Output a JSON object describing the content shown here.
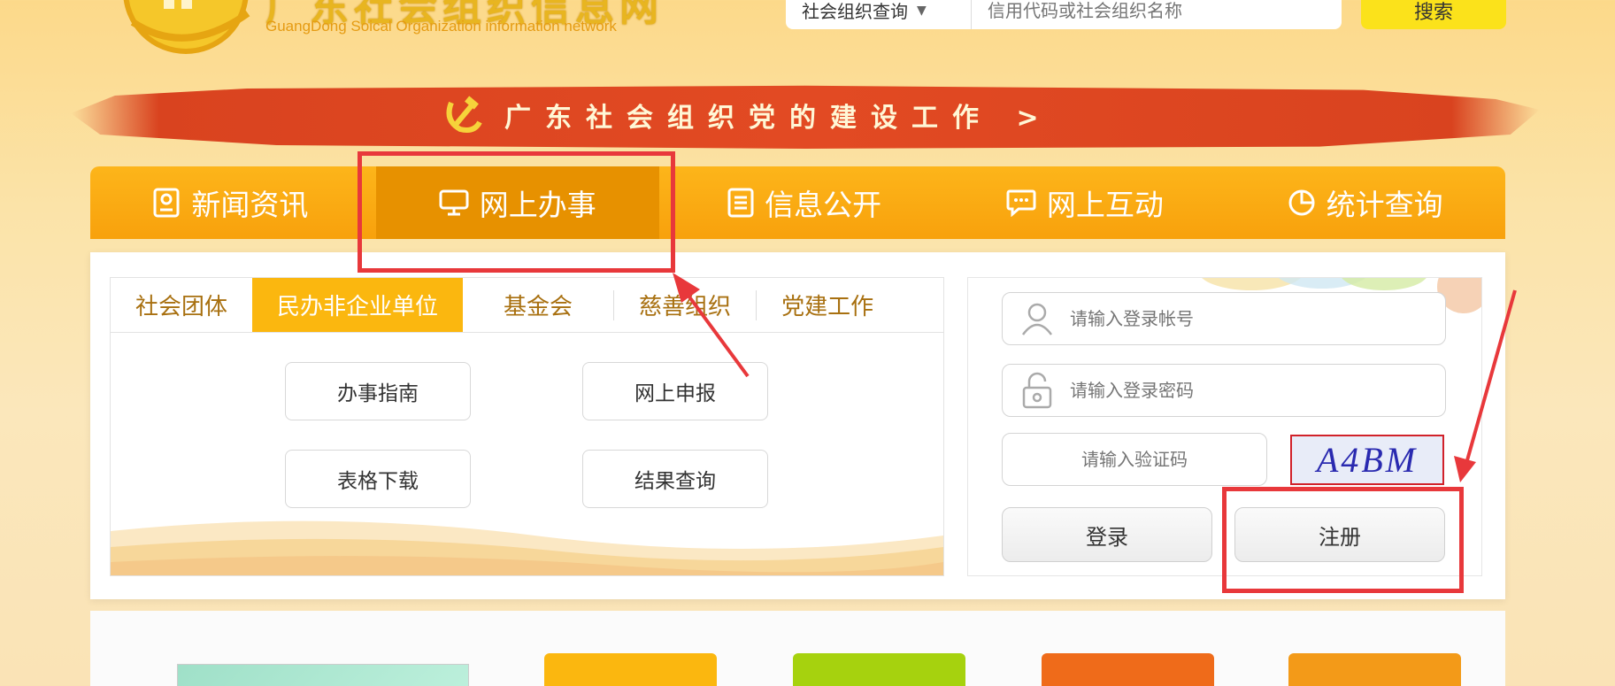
{
  "header": {
    "logo_cn": "广东社会组织信息网",
    "logo_en": "GuangDong Soical Organization information network",
    "search": {
      "select_value": "社会组织查询",
      "placeholder": "信用代码或社会组织名称",
      "button": "搜索"
    }
  },
  "banner": {
    "text": "广东社会组织党的建设工作 >"
  },
  "nav": {
    "items": [
      {
        "label": "新闻资讯",
        "icon": "person-card-icon"
      },
      {
        "label": "网上办事",
        "icon": "monitor-icon",
        "active": true
      },
      {
        "label": "信息公开",
        "icon": "document-icon"
      },
      {
        "label": "网上互动",
        "icon": "chat-icon"
      },
      {
        "label": "统计查询",
        "icon": "pie-chart-icon"
      }
    ]
  },
  "tabs": {
    "items": [
      "社会团体",
      "民办非企业单位",
      "基金会",
      "慈善组织",
      "党建工作"
    ],
    "active_index": 1
  },
  "services": {
    "guide": "办事指南",
    "online_apply": "网上申报",
    "form_download": "表格下载",
    "result_query": "结果查询"
  },
  "login": {
    "account_placeholder": "请输入登录帐号",
    "password_placeholder": "请输入登录密码",
    "captcha_placeholder": "请输入验证码",
    "captcha_text": "A4BM",
    "login_button": "登录",
    "register_button": "注册"
  },
  "colors": {
    "nav_bg": "#f8a10c",
    "nav_active": "#e79100",
    "tab_active": "#fbb70f",
    "annotation": "#e8383b",
    "banner": "#e24a23"
  }
}
